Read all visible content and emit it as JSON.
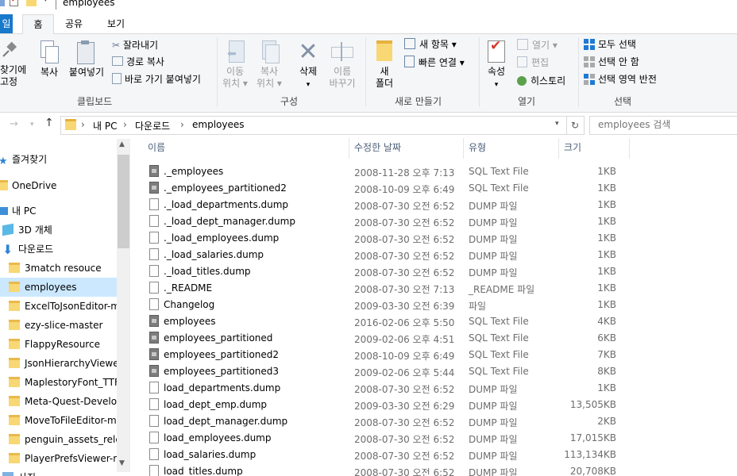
{
  "window": {
    "title": "employees"
  },
  "tabs": {
    "file": "일",
    "home": "홈",
    "share": "공유",
    "view": "보기"
  },
  "ribbon": {
    "clipboard": {
      "pin_line1": "찾기에",
      "pin_line2": "고정",
      "copy": "복사",
      "paste": "붙여넣기",
      "cut": "잘라내기",
      "copy_path": "경로 복사",
      "paste_shortcut": "바로 가기 붙여넣기",
      "group": "클립보드"
    },
    "organize": {
      "move_to_line1": "이동",
      "move_to_line2": "위치 ▾",
      "copy_to_line1": "복사",
      "copy_to_line2": "위치 ▾",
      "delete_line1": "삭제",
      "delete_line2": "▾",
      "rename_line1": "이름",
      "rename_line2": "바꾸기",
      "group": "구성"
    },
    "new": {
      "new_folder_line1": "새",
      "new_folder_line2": "폴더",
      "new_item": "새 항목 ▾",
      "easy_access": "빠른 연결 ▾",
      "group": "새로 만들기"
    },
    "open": {
      "properties_line1": "속성",
      "properties_line2": "▾",
      "open": "열기 ▾",
      "edit": "편집",
      "history": "히스토리",
      "group": "열기"
    },
    "select": {
      "select_all": "모두 선택",
      "select_none": "선택 안 함",
      "invert": "선택 영역 반전",
      "group": "선택"
    }
  },
  "address": {
    "crumbs": [
      "내 PC",
      "다운로드",
      "employees"
    ],
    "separator": "›",
    "search_placeholder": "employees 검색"
  },
  "navpane": {
    "items": [
      {
        "label": "즐겨찾기",
        "icon": "star-icon"
      },
      {
        "label": "OneDrive",
        "icon": "onedrive-icon"
      },
      {
        "label": "내 PC",
        "icon": "pc-icon"
      },
      {
        "label": "3D 개체",
        "icon": "3d-objects-icon"
      },
      {
        "label": "다운로드",
        "icon": "download-icon"
      },
      {
        "label": "3match resouce",
        "icon": "folder-icon"
      },
      {
        "label": "employees",
        "icon": "folder-icon",
        "selected": true
      },
      {
        "label": "ExcelToJsonEditor-ma",
        "icon": "folder-icon"
      },
      {
        "label": "ezy-slice-master",
        "icon": "folder-icon"
      },
      {
        "label": "FlappyResource",
        "icon": "folder-icon"
      },
      {
        "label": "JsonHierarchyViewer-",
        "icon": "folder-icon"
      },
      {
        "label": "MaplestoryFont_TTF",
        "icon": "folder-icon"
      },
      {
        "label": "Meta-Quest-Develope",
        "icon": "folder-icon"
      },
      {
        "label": "MoveToFileEditor-mas",
        "icon": "folder-icon"
      },
      {
        "label": "penguin_assets_releas",
        "icon": "folder-icon"
      },
      {
        "label": "PlayerPrefsViewer-ma",
        "icon": "folder-icon"
      },
      {
        "label": "사진",
        "icon": "pictures-icon"
      }
    ]
  },
  "filelist": {
    "columns": {
      "name": "이름",
      "date": "수정한 날짜",
      "type": "유형",
      "size": "크기"
    },
    "rows": [
      {
        "name": "._employees",
        "date": "2008-11-28 오후 7:13",
        "type": "SQL Text File",
        "size": "1KB",
        "icon": "sql"
      },
      {
        "name": "._employees_partitioned2",
        "date": "2008-10-09 오후 6:49",
        "type": "SQL Text File",
        "size": "1KB",
        "icon": "sql"
      },
      {
        "name": "._load_departments.dump",
        "date": "2008-07-30 오전 6:52",
        "type": "DUMP 파일",
        "size": "1KB",
        "icon": "file"
      },
      {
        "name": "._load_dept_manager.dump",
        "date": "2008-07-30 오전 6:52",
        "type": "DUMP 파일",
        "size": "1KB",
        "icon": "file"
      },
      {
        "name": "._load_employees.dump",
        "date": "2008-07-30 오전 6:52",
        "type": "DUMP 파일",
        "size": "1KB",
        "icon": "file"
      },
      {
        "name": "._load_salaries.dump",
        "date": "2008-07-30 오전 6:52",
        "type": "DUMP 파일",
        "size": "1KB",
        "icon": "file"
      },
      {
        "name": "._load_titles.dump",
        "date": "2008-07-30 오전 6:52",
        "type": "DUMP 파일",
        "size": "1KB",
        "icon": "file"
      },
      {
        "name": "._README",
        "date": "2008-07-30 오전 7:13",
        "type": "_README 파일",
        "size": "1KB",
        "icon": "file"
      },
      {
        "name": "Changelog",
        "date": "2009-03-30 오전 6:39",
        "type": "파일",
        "size": "1KB",
        "icon": "file"
      },
      {
        "name": "employees",
        "date": "2016-02-06 오후 5:50",
        "type": "SQL Text File",
        "size": "4KB",
        "icon": "sql"
      },
      {
        "name": "employees_partitioned",
        "date": "2009-02-06 오후 4:51",
        "type": "SQL Text File",
        "size": "6KB",
        "icon": "sql"
      },
      {
        "name": "employees_partitioned2",
        "date": "2008-10-09 오후 6:49",
        "type": "SQL Text File",
        "size": "7KB",
        "icon": "sql"
      },
      {
        "name": "employees_partitioned3",
        "date": "2009-02-06 오후 5:44",
        "type": "SQL Text File",
        "size": "8KB",
        "icon": "sql"
      },
      {
        "name": "load_departments.dump",
        "date": "2008-07-30 오전 6:52",
        "type": "DUMP 파일",
        "size": "1KB",
        "icon": "file"
      },
      {
        "name": "load_dept_emp.dump",
        "date": "2009-03-30 오전 6:29",
        "type": "DUMP 파일",
        "size": "13,505KB",
        "icon": "file"
      },
      {
        "name": "load_dept_manager.dump",
        "date": "2008-07-30 오전 6:52",
        "type": "DUMP 파일",
        "size": "2KB",
        "icon": "file"
      },
      {
        "name": "load_employees.dump",
        "date": "2008-07-30 오전 6:52",
        "type": "DUMP 파일",
        "size": "17,015KB",
        "icon": "file"
      },
      {
        "name": "load_salaries.dump",
        "date": "2008-07-30 오전 6:52",
        "type": "DUMP 파일",
        "size": "113,134KB",
        "icon": "file"
      },
      {
        "name": "load_titles.dump",
        "date": "2008-07-30 오전 6:52",
        "type": "DUMP 파일",
        "size": "20,708KB",
        "icon": "file"
      }
    ]
  }
}
